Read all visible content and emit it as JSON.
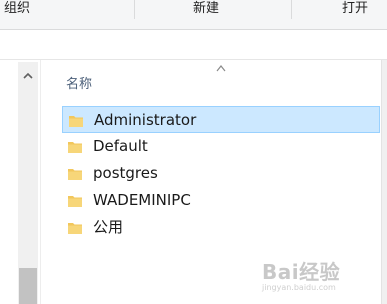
{
  "ribbon": {
    "groups": [
      "组织",
      "新建",
      "打开"
    ]
  },
  "file_list": {
    "column_header": "名称",
    "sort_direction": "ascending",
    "items": [
      {
        "name": "Administrator",
        "icon": "folder-icon",
        "selected": true
      },
      {
        "name": "Default",
        "icon": "folder-icon",
        "selected": false
      },
      {
        "name": "postgres",
        "icon": "folder-icon",
        "selected": false
      },
      {
        "name": "WADEMINIPC",
        "icon": "folder-icon",
        "selected": false
      },
      {
        "name": "公用",
        "icon": "folder-icon",
        "selected": false
      }
    ]
  },
  "watermark": {
    "text": "Bai经验",
    "subtext": "jingyan.baidu.com"
  },
  "colors": {
    "selection_fill": "#cce8ff",
    "selection_border": "#99d1ff",
    "folder_yellow": "#f2c75c",
    "header_text": "#4c607a"
  }
}
